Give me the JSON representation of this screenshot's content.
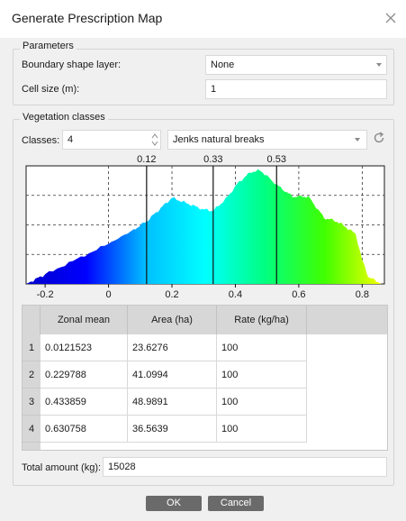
{
  "window": {
    "title": "Generate Prescription Map"
  },
  "parameters": {
    "group_title": "Parameters",
    "boundary_label": "Boundary shape layer:",
    "boundary_value": "None",
    "cell_size_label": "Cell size (m):",
    "cell_size_value": "1"
  },
  "vegetation": {
    "group_title": "Vegetation classes",
    "classes_label": "Classes:",
    "classes_value": "4",
    "method_value": "Jenks natural breaks"
  },
  "chart_data": {
    "type": "area",
    "x_ticks": [
      "-0.2",
      "0",
      "0.2",
      "0.4",
      "0.6",
      "0.8"
    ],
    "breaks": [
      0.12,
      0.33,
      0.53
    ],
    "break_labels": [
      "0.12",
      "0.33",
      "0.53"
    ],
    "x_range": [
      -0.26,
      0.87
    ],
    "grid": true,
    "gradient_colors": [
      "#0000cd",
      "#0000ff",
      "#00bfff",
      "#00ffff",
      "#00ff80",
      "#40ff00",
      "#ffff00"
    ],
    "x": [
      -0.26,
      -0.2,
      -0.1,
      0.0,
      0.08,
      0.12,
      0.16,
      0.2,
      0.26,
      0.3,
      0.33,
      0.37,
      0.41,
      0.45,
      0.48,
      0.53,
      0.58,
      0.63,
      0.68,
      0.72,
      0.75,
      0.78,
      0.8,
      0.82,
      0.86
    ],
    "y": [
      0.0,
      0.08,
      0.21,
      0.34,
      0.46,
      0.53,
      0.63,
      0.73,
      0.67,
      0.63,
      0.62,
      0.72,
      0.86,
      0.95,
      0.96,
      0.84,
      0.74,
      0.74,
      0.56,
      0.53,
      0.48,
      0.42,
      0.2,
      0.06,
      0.0
    ]
  },
  "table": {
    "headers": [
      "Zonal mean",
      "Area (ha)",
      "Rate (kg/ha)"
    ],
    "rows": [
      {
        "index": "1",
        "mean": "0.0121523",
        "area": "23.6276",
        "rate": "100"
      },
      {
        "index": "2",
        "mean": "0.229788",
        "area": "41.0994",
        "rate": "100"
      },
      {
        "index": "3",
        "mean": "0.433859",
        "area": "48.9891",
        "rate": "100"
      },
      {
        "index": "4",
        "mean": "0.630758",
        "area": "36.5639",
        "rate": "100"
      }
    ]
  },
  "total": {
    "label": "Total amount (kg):",
    "value": "15028"
  },
  "buttons": {
    "ok": "OK",
    "cancel": "Cancel"
  },
  "icons": {
    "close": "close-icon",
    "spin": "spin-arrows-icon",
    "refresh": "refresh-icon",
    "dropdown": "chevron-down-icon"
  }
}
